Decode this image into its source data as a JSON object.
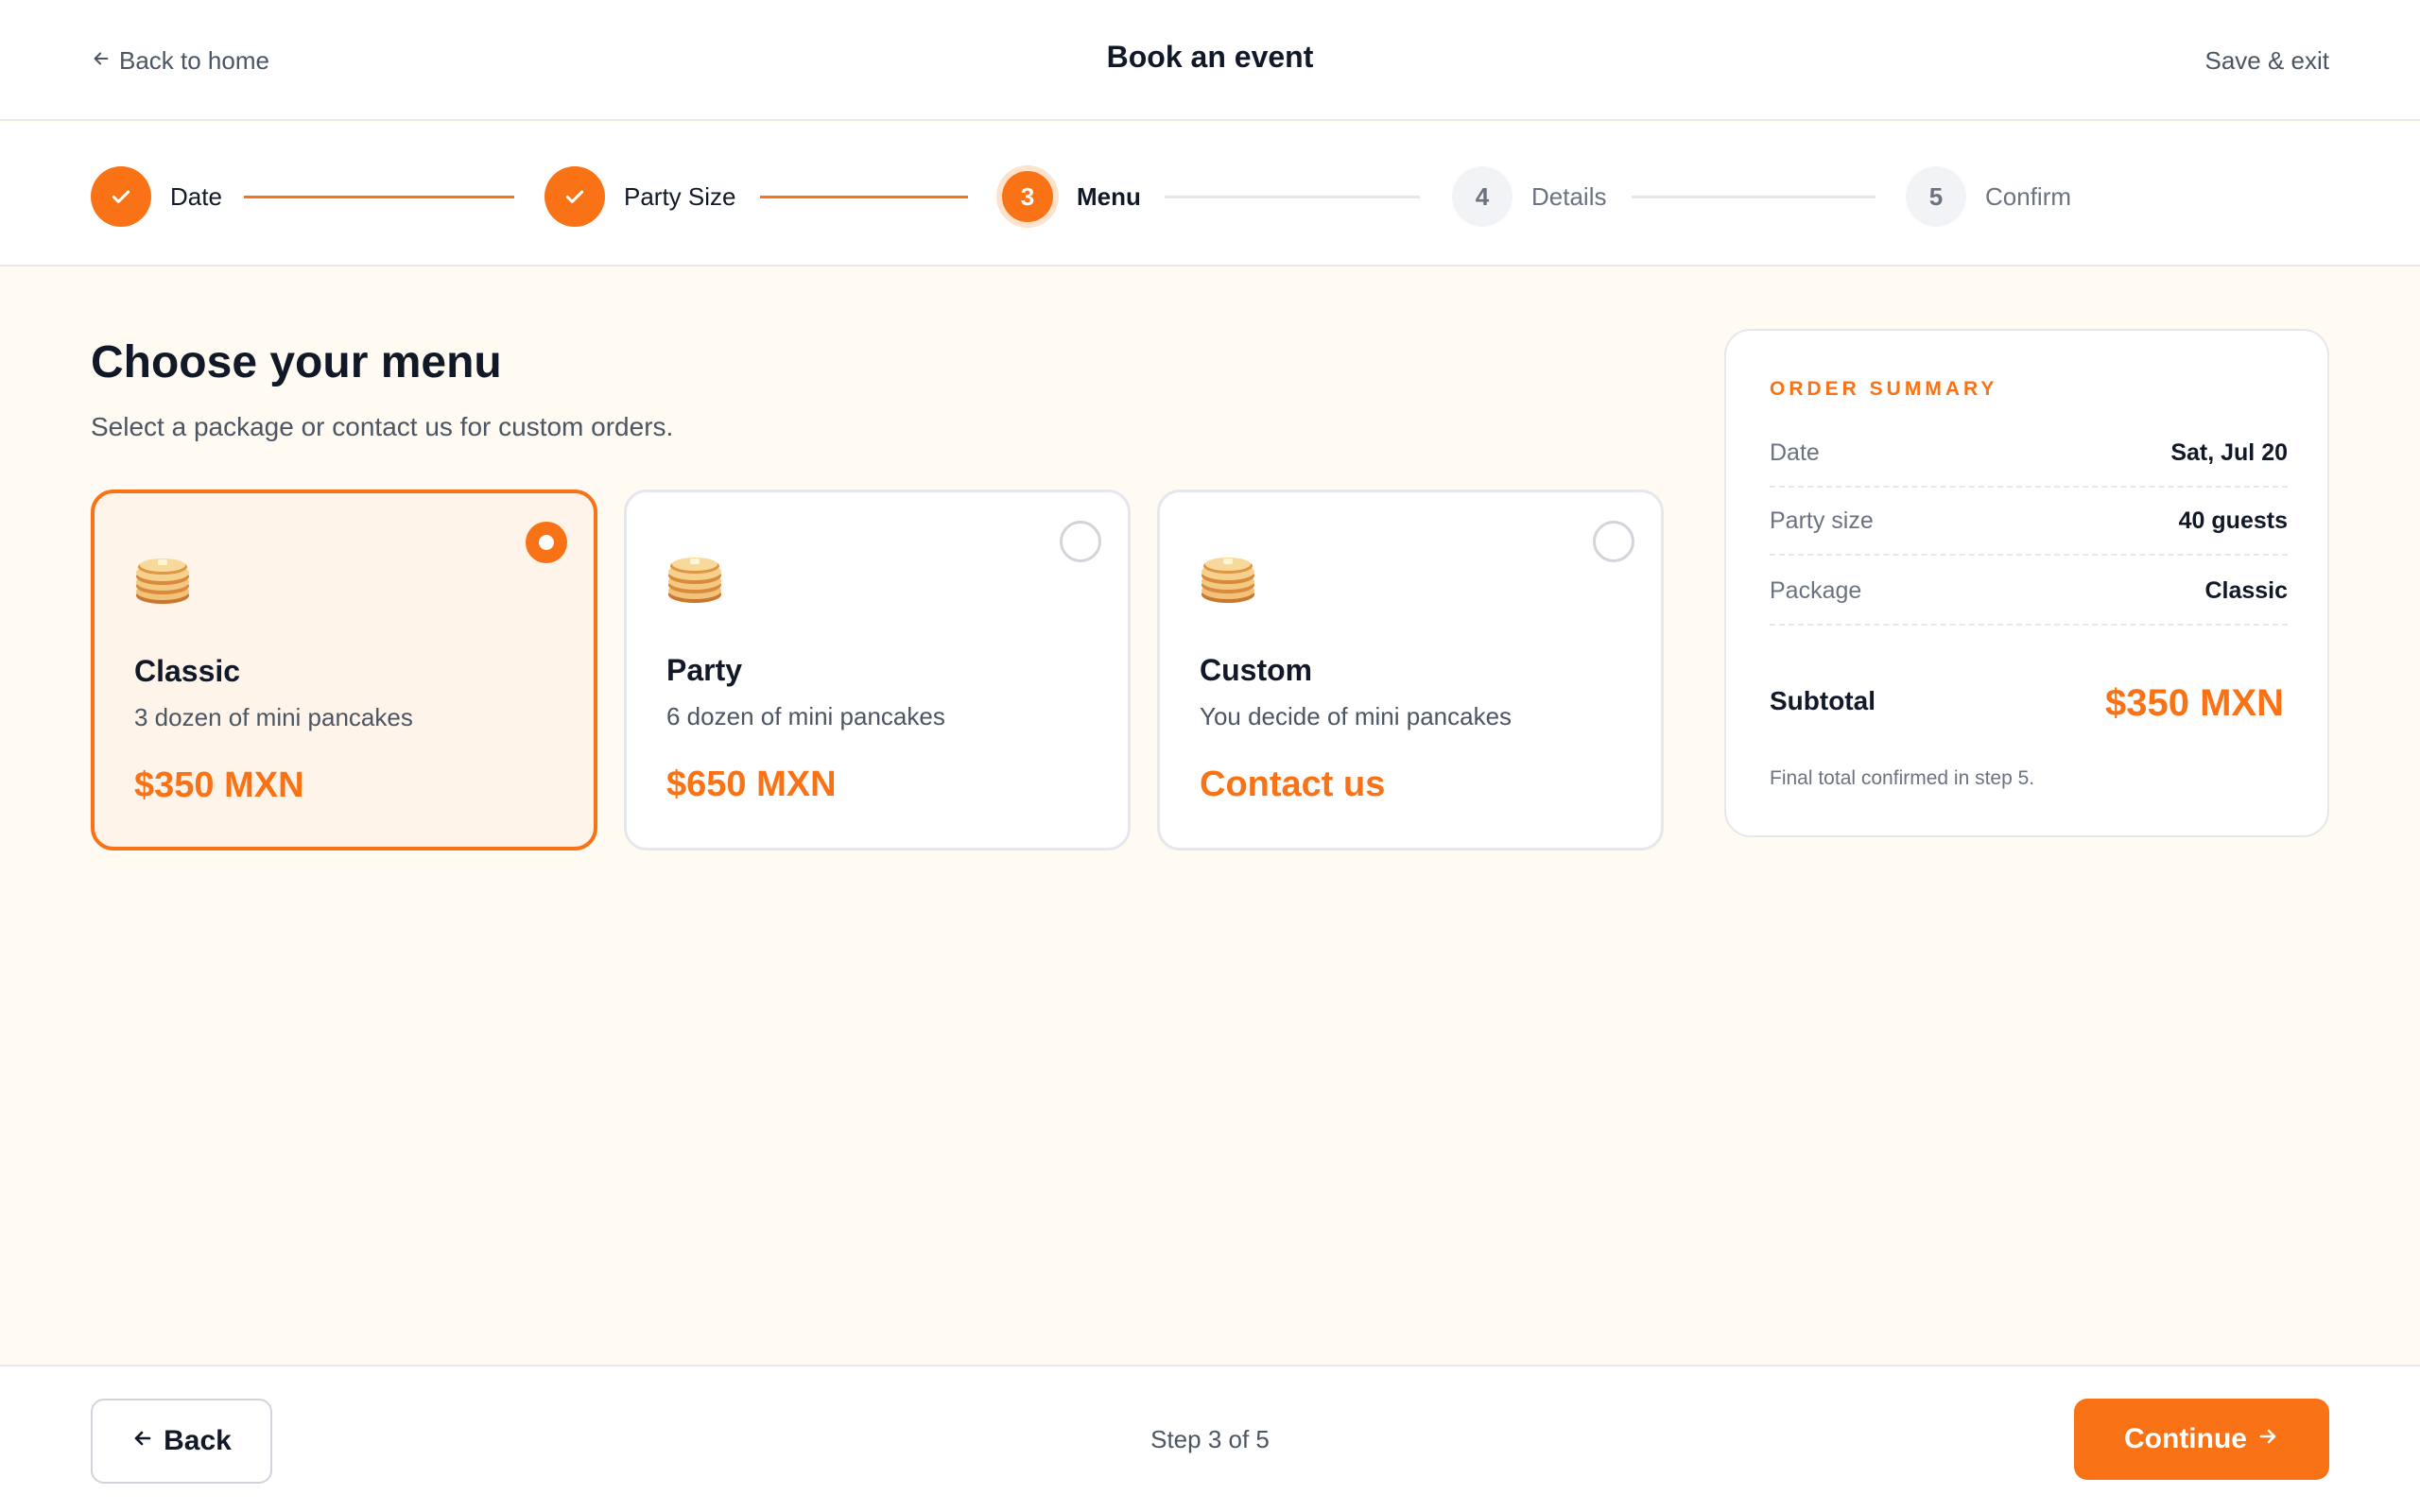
{
  "header": {
    "back_label": "Back to home",
    "title": "Book an event",
    "save_label": "Save & exit"
  },
  "stepper": {
    "steps": [
      {
        "number": "1",
        "label": "Date",
        "state": "done"
      },
      {
        "number": "2",
        "label": "Party Size",
        "state": "done"
      },
      {
        "number": "3",
        "label": "Menu",
        "state": "current"
      },
      {
        "number": "4",
        "label": "Details",
        "state": "todo"
      },
      {
        "number": "5",
        "label": "Confirm",
        "state": "todo"
      }
    ]
  },
  "main": {
    "title": "Choose your menu",
    "subtitle": "Select a package or contact us for custom orders.",
    "packages": [
      {
        "icon": "pancakes-icon",
        "name": "Classic",
        "description": "3 dozen of mini pancakes",
        "price": "$350 MXN",
        "selected": true
      },
      {
        "icon": "pancakes-icon",
        "name": "Party",
        "description": "6 dozen of mini pancakes",
        "price": "$650 MXN",
        "selected": false
      },
      {
        "icon": "pancakes-icon",
        "name": "Custom",
        "description": "You decide of mini pancakes",
        "price": "Contact us",
        "selected": false
      }
    ]
  },
  "summary": {
    "heading": "ORDER SUMMARY",
    "rows": [
      {
        "label": "Date",
        "value": "Sat, Jul 20"
      },
      {
        "label": "Party size",
        "value": "40 guests"
      },
      {
        "label": "Package",
        "value": "Classic"
      }
    ],
    "subtotal_label": "Subtotal",
    "subtotal_value": "$350 MXN",
    "note": "Final total confirmed in step 5."
  },
  "footer": {
    "back_label": "Back",
    "step_indicator": "Step 3 of 5",
    "continue_label": "Continue"
  },
  "colors": {
    "accent": "#f97316",
    "page_background": "#fffaf2",
    "selected_card_background": "#fff4ea"
  }
}
